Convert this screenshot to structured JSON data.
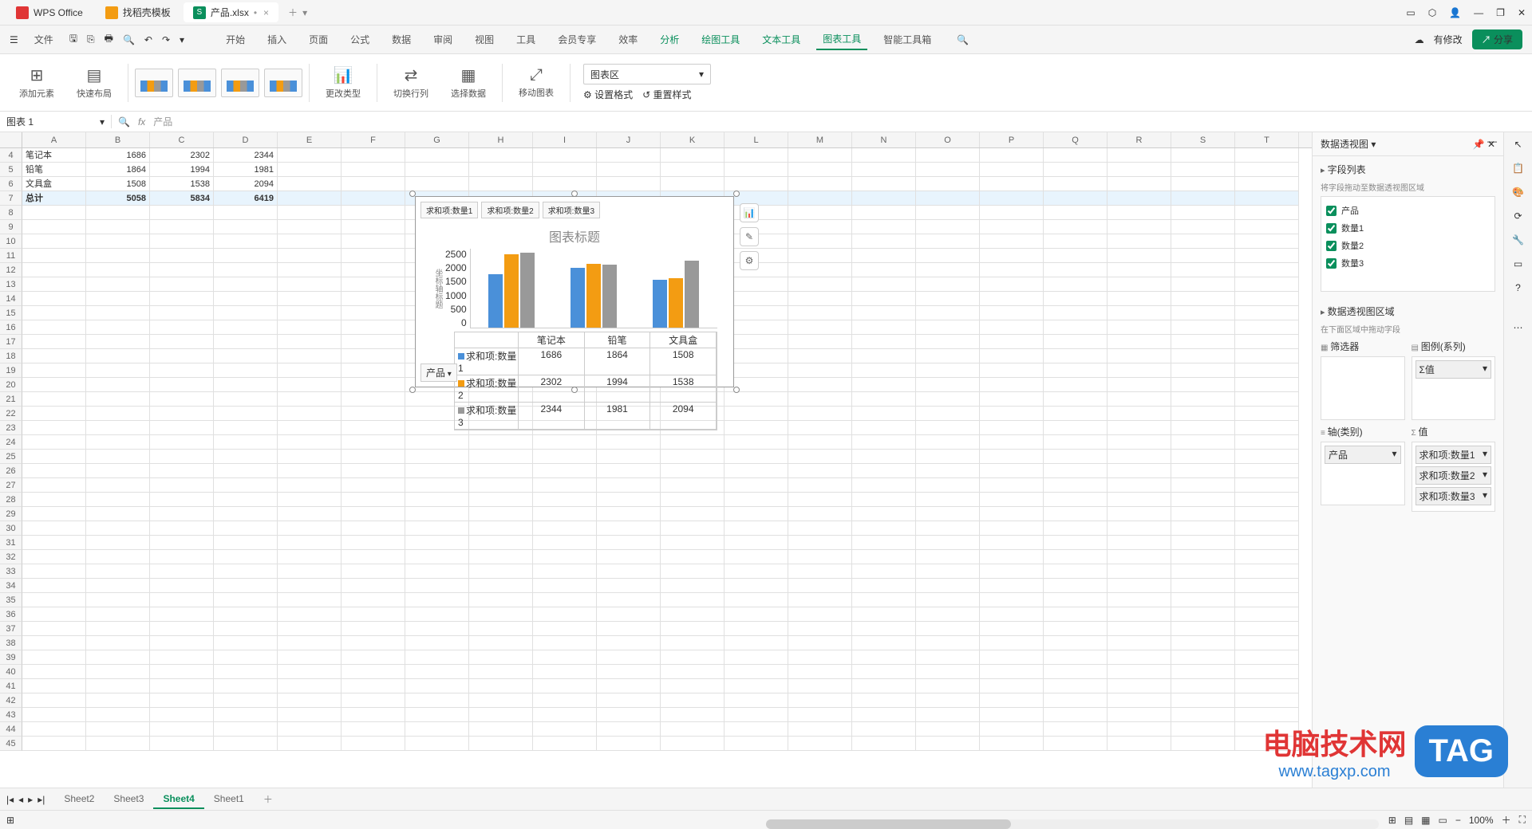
{
  "titlebar": {
    "app": "WPS Office",
    "tab_template": "找稻壳模板",
    "tab_file": "产品.xlsx",
    "modified": "•"
  },
  "win": {
    "min": "—",
    "max": "❐",
    "close": "✕"
  },
  "menubar": {
    "file": "文件",
    "items": [
      "开始",
      "插入",
      "页面",
      "公式",
      "数据",
      "审阅",
      "视图",
      "工具",
      "会员专享",
      "效率",
      "分析",
      "绘图工具",
      "文本工具",
      "图表工具",
      "智能工具箱"
    ],
    "modified": "有修改",
    "share": "分享"
  },
  "ribbon": {
    "add_element": "添加元素",
    "quick_layout": "快速布局",
    "change_type": "更改类型",
    "switch_rowcol": "切换行列",
    "select_data": "选择数据",
    "move_chart": "移动图表",
    "chart_area": "图表区",
    "set_format": "设置格式",
    "reset_style": "重置样式"
  },
  "formula": {
    "name": "图表 1",
    "fx": "fx",
    "value": "产品"
  },
  "sheet": {
    "cols": [
      "A",
      "B",
      "C",
      "D",
      "E",
      "F",
      "G",
      "H",
      "I",
      "J",
      "K",
      "L",
      "M",
      "N",
      "O",
      "P",
      "Q",
      "R",
      "S",
      "T"
    ],
    "rows": [
      {
        "n": 4,
        "A": "笔记本",
        "B": "1686",
        "C": "2302",
        "D": "2344"
      },
      {
        "n": 5,
        "A": "铅笔",
        "B": "1864",
        "C": "1994",
        "D": "1981"
      },
      {
        "n": 6,
        "A": "文具盒",
        "B": "1508",
        "C": "1538",
        "D": "2094"
      },
      {
        "n": 7,
        "A": "总计",
        "B": "5058",
        "C": "5834",
        "D": "6419",
        "bold": true,
        "hl": true
      }
    ],
    "empty_rows": [
      8,
      9,
      10,
      11,
      12,
      13,
      14,
      15,
      16,
      17,
      18,
      19,
      20,
      21,
      22,
      23,
      24,
      25,
      26,
      27,
      28,
      29,
      30,
      31,
      32,
      33,
      34,
      35,
      36,
      37,
      38,
      39,
      40,
      41,
      42,
      43,
      44,
      45
    ]
  },
  "chart_data": {
    "type": "bar",
    "title": "图表标题",
    "ylabel": "坐标轴标题",
    "ylim": [
      0,
      2500
    ],
    "yticks": [
      0,
      500,
      1000,
      1500,
      2000,
      2500
    ],
    "categories": [
      "笔记本",
      "铅笔",
      "文具盒"
    ],
    "series": [
      {
        "name": "求和项:数量1",
        "values": [
          1686,
          1864,
          1508
        ],
        "color": "#4a90d9"
      },
      {
        "name": "求和项:数量2",
        "values": [
          2302,
          1994,
          1538
        ],
        "color": "#f39c12"
      },
      {
        "name": "求和项:数量3",
        "values": [
          2344,
          1981,
          2094
        ],
        "color": "#999999"
      }
    ],
    "filter": "产品"
  },
  "pivot": {
    "title": "数据透视图",
    "field_list": "字段列表",
    "drag_hint": "将字段拖动至数据透视图区域",
    "fields": [
      "产品",
      "数量1",
      "数量2",
      "数量3"
    ],
    "area_title": "数据透视图区域",
    "area_hint": "在下面区域中拖动字段",
    "filter": "筛选器",
    "legend": "图例(系列)",
    "axis": "轴(类别)",
    "values": "值",
    "legend_val": "Σ值",
    "axis_val": "产品",
    "value_items": [
      "求和项:数量1",
      "求和项:数量2",
      "求和项:数量3"
    ]
  },
  "tabs": {
    "sheets": [
      "Sheet2",
      "Sheet3",
      "Sheet4",
      "Sheet1"
    ],
    "active": "Sheet4"
  },
  "status": {
    "zoom": "100%"
  },
  "watermark": {
    "cn": "电脑技术网",
    "url": "www.tagxp.com",
    "tag": "TAG"
  }
}
